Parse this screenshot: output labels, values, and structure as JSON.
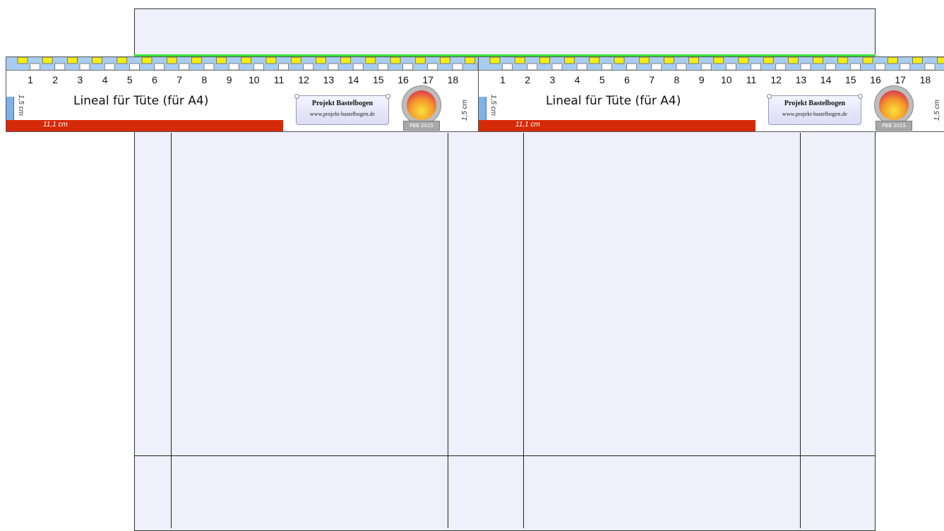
{
  "rulers": [
    {
      "numbers": [
        "1",
        "2",
        "3",
        "4",
        "5",
        "6",
        "7",
        "8",
        "9",
        "10",
        "11",
        "12",
        "13",
        "14",
        "15",
        "16",
        "17",
        "18"
      ],
      "title": "Lineal für Tüte (für A4)",
      "left_label": "1,5 cm",
      "right_label": "1,5 cm",
      "red_label": "11,1 cm",
      "scroll_title": "Projekt Bastelbogen",
      "scroll_url": "www.projekt-bastelbogen.de",
      "badge_label": "PBB 2015"
    },
    {
      "numbers": [
        "1",
        "2",
        "3",
        "4",
        "5",
        "6",
        "7",
        "8",
        "9",
        "10",
        "11",
        "12",
        "13",
        "14",
        "15",
        "16",
        "17",
        "18"
      ],
      "title": "Lineal für Tüte (für A4)",
      "left_label": "1,5 cm",
      "right_label": "1,5 cm",
      "red_label": "11,1 cm",
      "scroll_title": "Projekt Bastelbogen",
      "scroll_url": "www.projekt-bastelbogen.de",
      "badge_label": "PBB 2015"
    }
  ],
  "colors": {
    "sheet": "#eff0fc",
    "ruler_band": "#a8cdf0",
    "tick_yellow": "#f2ec1a",
    "red_bar": "#d42a0a",
    "guide_green": "#38e038"
  }
}
